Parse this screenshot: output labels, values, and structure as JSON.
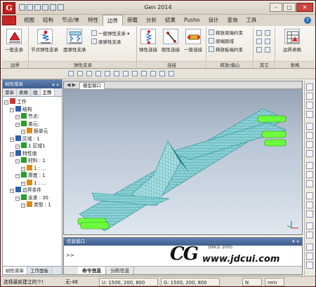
{
  "app": {
    "title": "Gen 2014",
    "logo_letter": "G"
  },
  "ribbon_tabs": [
    "视图",
    "结构",
    "节点/单",
    "特性",
    "边界",
    "荷载",
    "分析",
    "结果",
    "Pusho",
    "设计",
    "查询",
    "工具"
  ],
  "active_tab": "边界",
  "ribbon": {
    "groups": [
      {
        "label": "边界",
        "buttons": [
          "一般支承"
        ]
      },
      {
        "label": "弹性支承",
        "buttons": [
          "节点弹性支承",
          "面弹性支承",
          "一般弹性支承",
          "梁弹性支承"
        ]
      },
      {
        "label": "连接",
        "buttons": [
          "弹性连接",
          "刚性连接",
          "一般连接"
        ]
      },
      {
        "label": "释放/偏心",
        "buttons": [
          "释放梁端约束",
          "梁端刚域",
          "释放板端约束"
        ]
      },
      {
        "label": "其它",
        "buttons": []
      },
      {
        "label": "表格",
        "buttons": [
          "边界表格"
        ]
      }
    ]
  },
  "left_panel": {
    "title": "树形菜单",
    "pin": "▾ ×",
    "tabs": [
      "菜单",
      "表格",
      "组",
      "工作"
    ],
    "active_tab": "工作",
    "tree": [
      {
        "label": "工作",
        "level": 0
      },
      {
        "label": "结构",
        "level": 1
      },
      {
        "label": "节点:",
        "level": 2
      },
      {
        "label": "单元:",
        "level": 2
      },
      {
        "label": "板单元",
        "level": 3
      },
      {
        "label": "区域 : 1",
        "level": 1
      },
      {
        "label": "1 区域1",
        "level": 2
      },
      {
        "label": "特性值",
        "level": 1
      },
      {
        "label": "材料 : 1",
        "level": 2
      },
      {
        "label": "1 : ...",
        "level": 3
      },
      {
        "label": "厚度 : 1",
        "level": 2
      },
      {
        "label": "1 : ...",
        "level": 3
      },
      {
        "label": "边界条件",
        "level": 1
      },
      {
        "label": "支承 : 30",
        "level": 2
      },
      {
        "label": "类型 : 1",
        "level": 3
      }
    ],
    "bottom_tabs": [
      "树形菜单",
      "工作面板"
    ],
    "active_bottom_tab": "树形菜单"
  },
  "viewport": {
    "tab_label": "模型窗口",
    "nav": "◀ ▶"
  },
  "info_panel": {
    "title": "信息窗口",
    "controls": "▾ ×",
    "prompt": ">>",
    "tabs": [
      "命令信息",
      "分析信息"
    ],
    "active_tab": "命令信息"
  },
  "statusbar": {
    "help_text": "选择最新建立的个!",
    "none": "无-46",
    "u_coord": "U: 1500, 200, 800",
    "g_coord": "G: 1500, 200, 800",
    "unit": "N",
    "length_unit": "mm"
  },
  "watermark": {
    "logo": "CG",
    "since": "SINCE 2005",
    "url": "www.jdcui.com"
  },
  "colors": {
    "mesh": "#2aa6a6",
    "support": "#6bff3c",
    "accent": "#c21d1d"
  }
}
